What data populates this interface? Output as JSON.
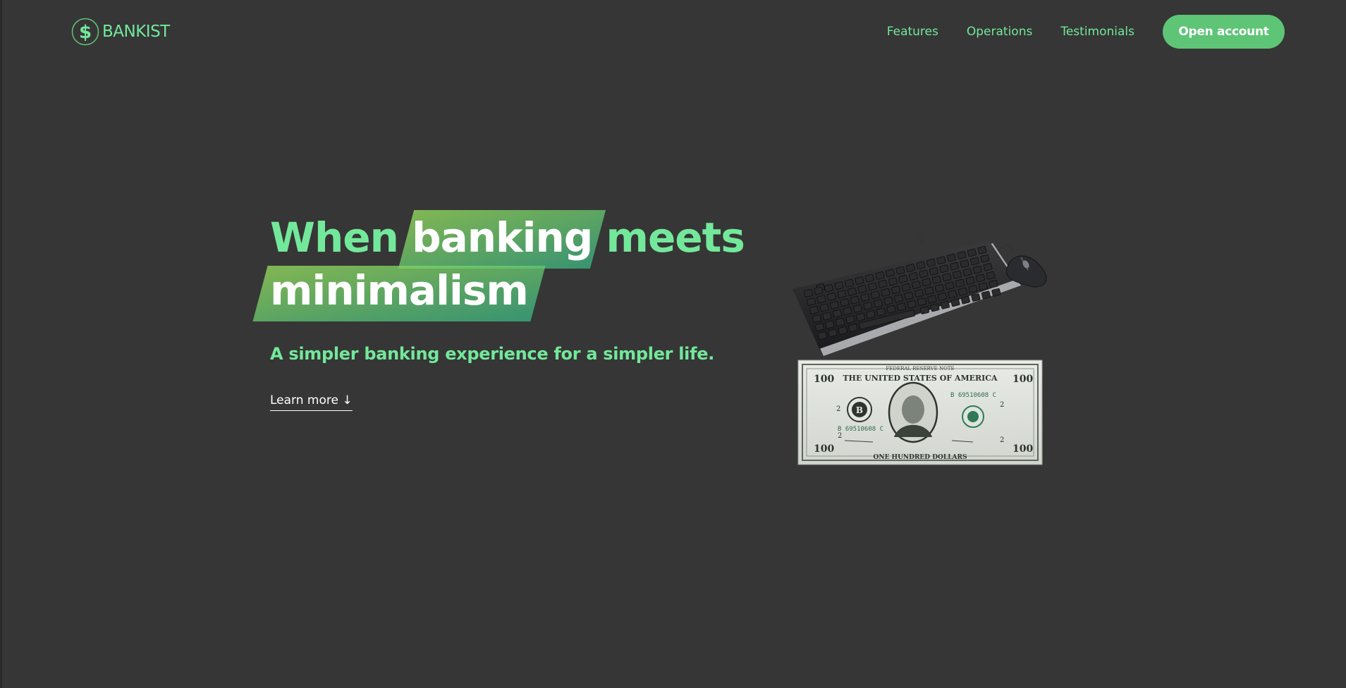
{
  "nav": {
    "logo_text": "BANKIST",
    "links": [
      {
        "label": "Features"
      },
      {
        "label": "Operations"
      },
      {
        "label": "Testimonials"
      }
    ],
    "cta_label": "Open account"
  },
  "hero": {
    "title_word_1": "When",
    "title_highlight_1": "banking",
    "title_word_2": "meets",
    "title_highlight_2": "minimalism",
    "subtitle": "A simpler banking experience for a simpler life.",
    "learn_more": "Learn more ↓"
  },
  "banknote": {
    "top_band": "FEDERAL RESERVE NOTE",
    "header": "THE UNITED STATES OF AMERICA",
    "denomination": "100",
    "serial": "B 69510608 C",
    "seal_letter": "B",
    "district": "2",
    "bottom_band": "ONE HUNDRED DOLLARS"
  },
  "colors": {
    "background": "#363636",
    "accent": "#73e89b",
    "button": "#5ec576",
    "highlight_from": "#9be15d",
    "highlight_to": "#39b385"
  }
}
